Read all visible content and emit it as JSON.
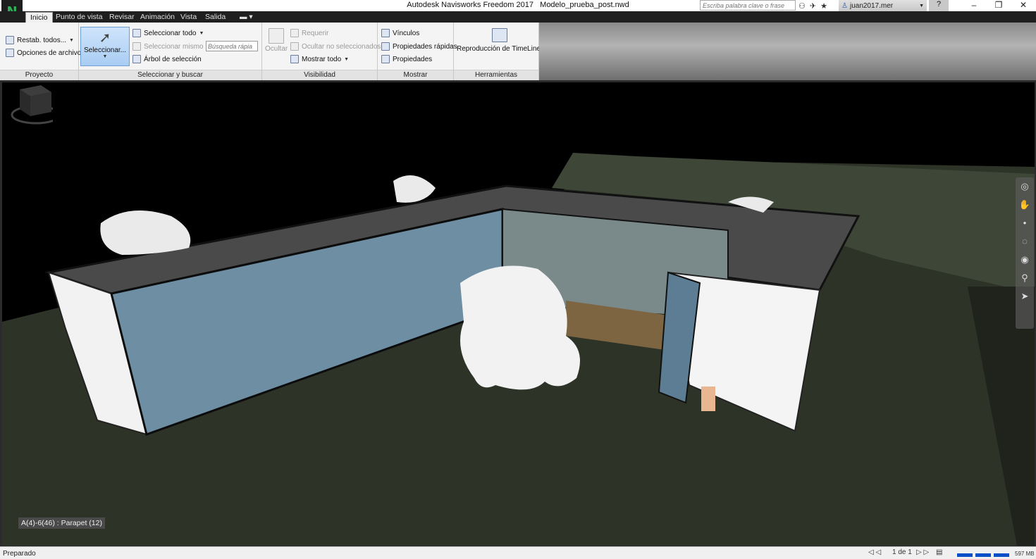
{
  "window": {
    "app_title": "Autodesk Navisworks Freedom 2017",
    "file_name": "Modelo_prueba_post.nwd",
    "search_placeholder": "Escriba palabra clave o frase",
    "user_name": "juan2017.mer",
    "help_label": "?"
  },
  "menu": {
    "tabs": [
      "Inicio",
      "Punto de vista",
      "Revisar",
      "Animación",
      "Vista",
      "Salida"
    ],
    "active": "Inicio"
  },
  "ribbon": {
    "proyecto": {
      "title": "Proyecto",
      "reset_all": "Restab. todos...",
      "file_options": "Opciones de archivo"
    },
    "seleccionar": {
      "title": "Seleccionar y buscar",
      "select_button": "Seleccionar...",
      "select_all": "Seleccionar todo",
      "select_same": "Seleccionar mismo",
      "selection_tree": "Árbol de selección",
      "quick_find_placeholder": "Búsqueda rápia"
    },
    "visibilidad": {
      "title": "Visibilidad",
      "hide": "Ocultar",
      "require": "Requerir",
      "hide_unselected": "Ocultar no seleccionados",
      "show_all": "Mostrar todo"
    },
    "mostrar": {
      "title": "Mostrar",
      "links": "Vínculos",
      "quick_properties": "Propiedades rápidas",
      "properties": "Propiedades"
    },
    "herramientas": {
      "title": "Herramientas",
      "timeliner": "Reproducción de TimeLiner"
    }
  },
  "viewport": {
    "tooltip": "A(4)-6(46) : Parapet (12)"
  },
  "statusbar": {
    "status": "Preparado",
    "page": "1 de 1",
    "memory": "597 MB"
  },
  "colors": {
    "accent": "#2fb35a",
    "ribbon_bg": "#f4f4f4",
    "ground": "#2e3328",
    "roof": "#4a4a4a",
    "glass": "#6d8ea3"
  }
}
